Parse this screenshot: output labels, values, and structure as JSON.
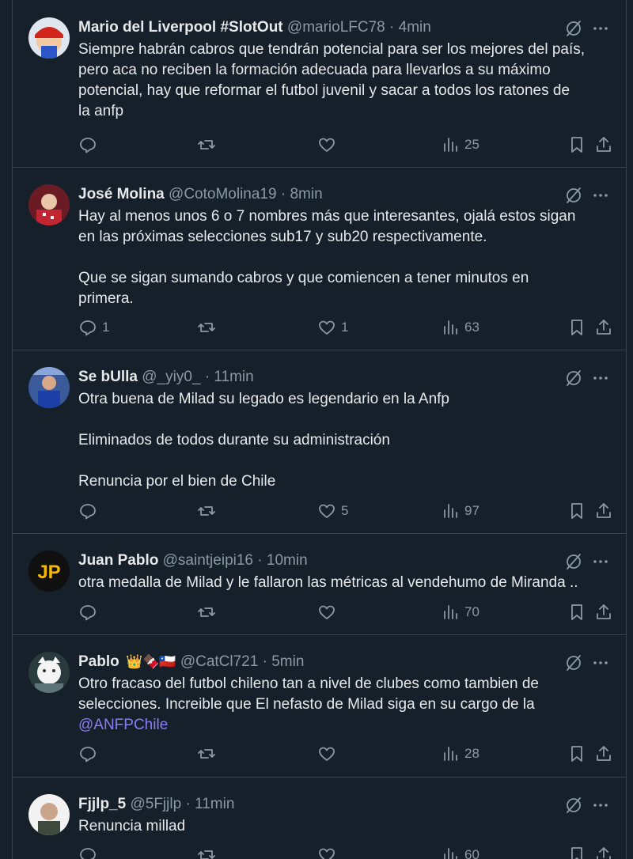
{
  "tweets": [
    {
      "name": "Mario del Liverpool #SlotOut",
      "emoji": "",
      "handle": "@marioLFC78",
      "time": "4min",
      "lines": [
        "Siempre habrán cabros que tendrán potencial para ser los mejores del país,",
        "pero aca no reciben la formación adecuada para llevarlos a su máximo",
        "potencial, hay que reformar el futbol juvenil y sacar a todos los ratones de",
        "la anfp"
      ],
      "replies": "",
      "retweets": "",
      "likes": "",
      "views": "25"
    },
    {
      "name": "José Molina",
      "emoji": "",
      "handle": "@CotoMolina19",
      "time": "8min",
      "lines": [
        "Hay al menos unos 6 o 7 nombres más que interesantes, ojalá estos sigan",
        "en las próximas selecciones sub17 y sub20 respectivamente.",
        "",
        "Que se sigan sumando cabros y que comiencen a tener minutos en",
        "primera."
      ],
      "replies": "1",
      "retweets": "",
      "likes": "1",
      "views": "63"
    },
    {
      "name": "Se bUlla",
      "emoji": "",
      "handle": "@_yiy0_",
      "time": "11min",
      "lines": [
        "Otra buena de Milad su legado es legendario en la Anfp",
        "",
        "Eliminados de todos durante su administración",
        "",
        "Renuncia por el bien de Chile"
      ],
      "replies": "",
      "retweets": "",
      "likes": "5",
      "views": "97"
    },
    {
      "name": "Juan Pablo",
      "emoji": "",
      "handle": "@saintjeipi16",
      "time": "10min",
      "lines": [
        "otra medalla de Milad y le fallaron las métricas al vendehumo de Miranda .."
      ],
      "replies": "",
      "retweets": "",
      "likes": "",
      "views": "70"
    },
    {
      "name": "Pablo",
      "emoji": "👑🍫🇨🇱",
      "handle": "@CatCl721",
      "time": "5min",
      "lines": [
        "Otro fracaso del futbol chileno tan a nivel de clubes como tambien de",
        "selecciones. Increible que El nefasto de Milad siga en su cargo de la"
      ],
      "mention": "@ANFPChile",
      "replies": "",
      "retweets": "",
      "likes": "",
      "views": "28"
    },
    {
      "name": "Fjjlp_5",
      "emoji": "",
      "handle": "@5Fjjlp",
      "time": "11min",
      "lines": [
        "Renuncia millad"
      ],
      "replies": "",
      "retweets": "",
      "likes": "",
      "views": "60"
    }
  ],
  "separator": "·"
}
